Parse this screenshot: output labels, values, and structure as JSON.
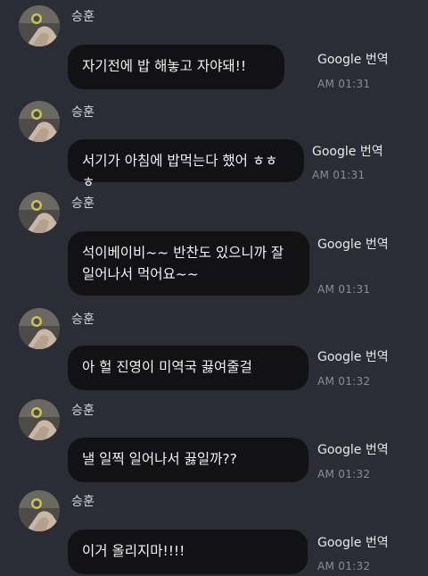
{
  "messages": [
    {
      "sender": "승훈",
      "text": "자기전에 밥 해놓고 자야돼!!",
      "translate_label": "Google 번역",
      "time": "AM 01:31"
    },
    {
      "sender": "승훈",
      "text": "서기가 아침에 밥먹는다 했어 ㅎㅎㅎ",
      "translate_label": "Google 번역",
      "time": "AM 01:31"
    },
    {
      "sender": "승훈",
      "text": "석이베이비~~ 반찬도 있으니까 잘 일어나서 먹어요~~",
      "translate_label": "Google 번역",
      "time": "AM 01:31"
    },
    {
      "sender": "승훈",
      "text": "아 헐 진영이 미역국 끓여줄걸",
      "translate_label": "Google 번역",
      "time": "AM 01:32"
    },
    {
      "sender": "승훈",
      "text": "낼 일찍 일어나서 끓일까??",
      "translate_label": "Google 번역",
      "time": "AM 01:32"
    },
    {
      "sender": "승훈",
      "text": "이거 올리지마!!!!",
      "translate_label": "Google 번역",
      "time": "AM 01:32"
    }
  ],
  "colors": {
    "background": "#2a2c36",
    "bubble": "#121215",
    "time": "#8c8d93"
  }
}
